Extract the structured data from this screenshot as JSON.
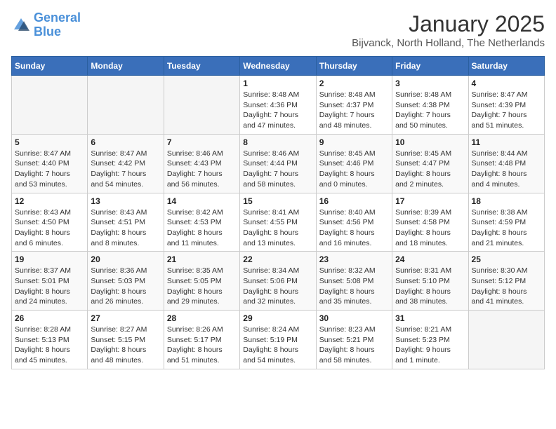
{
  "header": {
    "logo_line1": "General",
    "logo_line2": "Blue",
    "month": "January 2025",
    "location": "Bijvanck, North Holland, The Netherlands"
  },
  "weekdays": [
    "Sunday",
    "Monday",
    "Tuesday",
    "Wednesday",
    "Thursday",
    "Friday",
    "Saturday"
  ],
  "weeks": [
    [
      {
        "day": "",
        "detail": ""
      },
      {
        "day": "",
        "detail": ""
      },
      {
        "day": "",
        "detail": ""
      },
      {
        "day": "1",
        "detail": "Sunrise: 8:48 AM\nSunset: 4:36 PM\nDaylight: 7 hours\nand 47 minutes."
      },
      {
        "day": "2",
        "detail": "Sunrise: 8:48 AM\nSunset: 4:37 PM\nDaylight: 7 hours\nand 48 minutes."
      },
      {
        "day": "3",
        "detail": "Sunrise: 8:48 AM\nSunset: 4:38 PM\nDaylight: 7 hours\nand 50 minutes."
      },
      {
        "day": "4",
        "detail": "Sunrise: 8:47 AM\nSunset: 4:39 PM\nDaylight: 7 hours\nand 51 minutes."
      }
    ],
    [
      {
        "day": "5",
        "detail": "Sunrise: 8:47 AM\nSunset: 4:40 PM\nDaylight: 7 hours\nand 53 minutes."
      },
      {
        "day": "6",
        "detail": "Sunrise: 8:47 AM\nSunset: 4:42 PM\nDaylight: 7 hours\nand 54 minutes."
      },
      {
        "day": "7",
        "detail": "Sunrise: 8:46 AM\nSunset: 4:43 PM\nDaylight: 7 hours\nand 56 minutes."
      },
      {
        "day": "8",
        "detail": "Sunrise: 8:46 AM\nSunset: 4:44 PM\nDaylight: 7 hours\nand 58 minutes."
      },
      {
        "day": "9",
        "detail": "Sunrise: 8:45 AM\nSunset: 4:46 PM\nDaylight: 8 hours\nand 0 minutes."
      },
      {
        "day": "10",
        "detail": "Sunrise: 8:45 AM\nSunset: 4:47 PM\nDaylight: 8 hours\nand 2 minutes."
      },
      {
        "day": "11",
        "detail": "Sunrise: 8:44 AM\nSunset: 4:48 PM\nDaylight: 8 hours\nand 4 minutes."
      }
    ],
    [
      {
        "day": "12",
        "detail": "Sunrise: 8:43 AM\nSunset: 4:50 PM\nDaylight: 8 hours\nand 6 minutes."
      },
      {
        "day": "13",
        "detail": "Sunrise: 8:43 AM\nSunset: 4:51 PM\nDaylight: 8 hours\nand 8 minutes."
      },
      {
        "day": "14",
        "detail": "Sunrise: 8:42 AM\nSunset: 4:53 PM\nDaylight: 8 hours\nand 11 minutes."
      },
      {
        "day": "15",
        "detail": "Sunrise: 8:41 AM\nSunset: 4:55 PM\nDaylight: 8 hours\nand 13 minutes."
      },
      {
        "day": "16",
        "detail": "Sunrise: 8:40 AM\nSunset: 4:56 PM\nDaylight: 8 hours\nand 16 minutes."
      },
      {
        "day": "17",
        "detail": "Sunrise: 8:39 AM\nSunset: 4:58 PM\nDaylight: 8 hours\nand 18 minutes."
      },
      {
        "day": "18",
        "detail": "Sunrise: 8:38 AM\nSunset: 4:59 PM\nDaylight: 8 hours\nand 21 minutes."
      }
    ],
    [
      {
        "day": "19",
        "detail": "Sunrise: 8:37 AM\nSunset: 5:01 PM\nDaylight: 8 hours\nand 24 minutes."
      },
      {
        "day": "20",
        "detail": "Sunrise: 8:36 AM\nSunset: 5:03 PM\nDaylight: 8 hours\nand 26 minutes."
      },
      {
        "day": "21",
        "detail": "Sunrise: 8:35 AM\nSunset: 5:05 PM\nDaylight: 8 hours\nand 29 minutes."
      },
      {
        "day": "22",
        "detail": "Sunrise: 8:34 AM\nSunset: 5:06 PM\nDaylight: 8 hours\nand 32 minutes."
      },
      {
        "day": "23",
        "detail": "Sunrise: 8:32 AM\nSunset: 5:08 PM\nDaylight: 8 hours\nand 35 minutes."
      },
      {
        "day": "24",
        "detail": "Sunrise: 8:31 AM\nSunset: 5:10 PM\nDaylight: 8 hours\nand 38 minutes."
      },
      {
        "day": "25",
        "detail": "Sunrise: 8:30 AM\nSunset: 5:12 PM\nDaylight: 8 hours\nand 41 minutes."
      }
    ],
    [
      {
        "day": "26",
        "detail": "Sunrise: 8:28 AM\nSunset: 5:13 PM\nDaylight: 8 hours\nand 45 minutes."
      },
      {
        "day": "27",
        "detail": "Sunrise: 8:27 AM\nSunset: 5:15 PM\nDaylight: 8 hours\nand 48 minutes."
      },
      {
        "day": "28",
        "detail": "Sunrise: 8:26 AM\nSunset: 5:17 PM\nDaylight: 8 hours\nand 51 minutes."
      },
      {
        "day": "29",
        "detail": "Sunrise: 8:24 AM\nSunset: 5:19 PM\nDaylight: 8 hours\nand 54 minutes."
      },
      {
        "day": "30",
        "detail": "Sunrise: 8:23 AM\nSunset: 5:21 PM\nDaylight: 8 hours\nand 58 minutes."
      },
      {
        "day": "31",
        "detail": "Sunrise: 8:21 AM\nSunset: 5:23 PM\nDaylight: 9 hours\nand 1 minute."
      },
      {
        "day": "",
        "detail": ""
      }
    ]
  ]
}
